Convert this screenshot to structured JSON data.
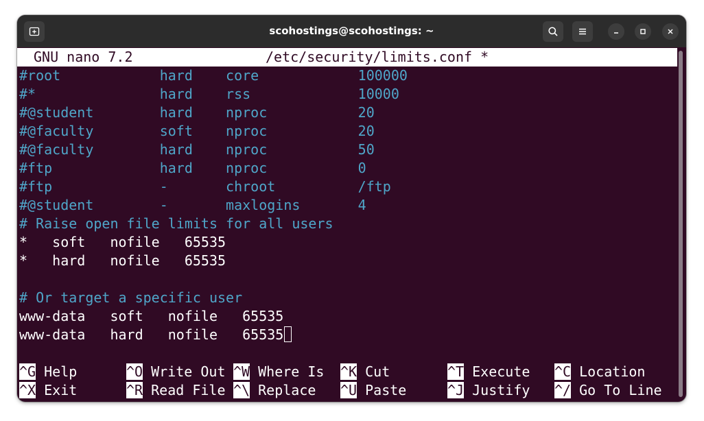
{
  "window": {
    "title": "scohostings@scohostings: ~"
  },
  "icons": {
    "new_tab": "new-tab-icon",
    "search": "search-icon",
    "menu": "hamburger-menu-icon",
    "minimize": "minimize-icon",
    "maximize": "maximize-icon",
    "close": "close-icon"
  },
  "nano": {
    "version": "GNU nano 7.2",
    "filename": "/etc/security/limits.conf *"
  },
  "lines": [
    {
      "text": "#root            hard    core            100000",
      "kind": "comment"
    },
    {
      "text": "#*               hard    rss             10000",
      "kind": "comment"
    },
    {
      "text": "#@student        hard    nproc           20",
      "kind": "comment"
    },
    {
      "text": "#@faculty        soft    nproc           20",
      "kind": "comment"
    },
    {
      "text": "#@faculty        hard    nproc           50",
      "kind": "comment"
    },
    {
      "text": "#ftp             hard    nproc           0",
      "kind": "comment"
    },
    {
      "text": "#ftp             -       chroot          /ftp",
      "kind": "comment"
    },
    {
      "text": "#@student        -       maxlogins       4",
      "kind": "comment"
    },
    {
      "text": "# Raise open file limits for all users",
      "kind": "comment"
    },
    {
      "text": "*   soft   nofile   65535",
      "kind": "normal"
    },
    {
      "text": "*   hard   nofile   65535",
      "kind": "normal"
    },
    {
      "text": "",
      "kind": "normal"
    },
    {
      "text": "# Or target a specific user",
      "kind": "comment"
    },
    {
      "text": "www-data   soft   nofile   65535",
      "kind": "normal"
    },
    {
      "text": "www-data   hard   nofile   65535",
      "kind": "normal"
    }
  ],
  "shortcuts": [
    [
      {
        "key": "^G",
        "label": "Help"
      },
      {
        "key": "^O",
        "label": "Write Out"
      },
      {
        "key": "^W",
        "label": "Where Is"
      },
      {
        "key": "^K",
        "label": "Cut"
      },
      {
        "key": "^T",
        "label": "Execute"
      },
      {
        "key": "^C",
        "label": "Location"
      }
    ],
    [
      {
        "key": "^X",
        "label": "Exit"
      },
      {
        "key": "^R",
        "label": "Read File"
      },
      {
        "key": "^\\",
        "label": "Replace"
      },
      {
        "key": "^U",
        "label": "Paste"
      },
      {
        "key": "^J",
        "label": "Justify"
      },
      {
        "key": "^/",
        "label": "Go To Line"
      }
    ]
  ],
  "colors": {
    "terminal_bg": "#300a24",
    "comment": "#4fa6c9",
    "text": "#ffffff",
    "titlebar": "#2c2c2c"
  }
}
